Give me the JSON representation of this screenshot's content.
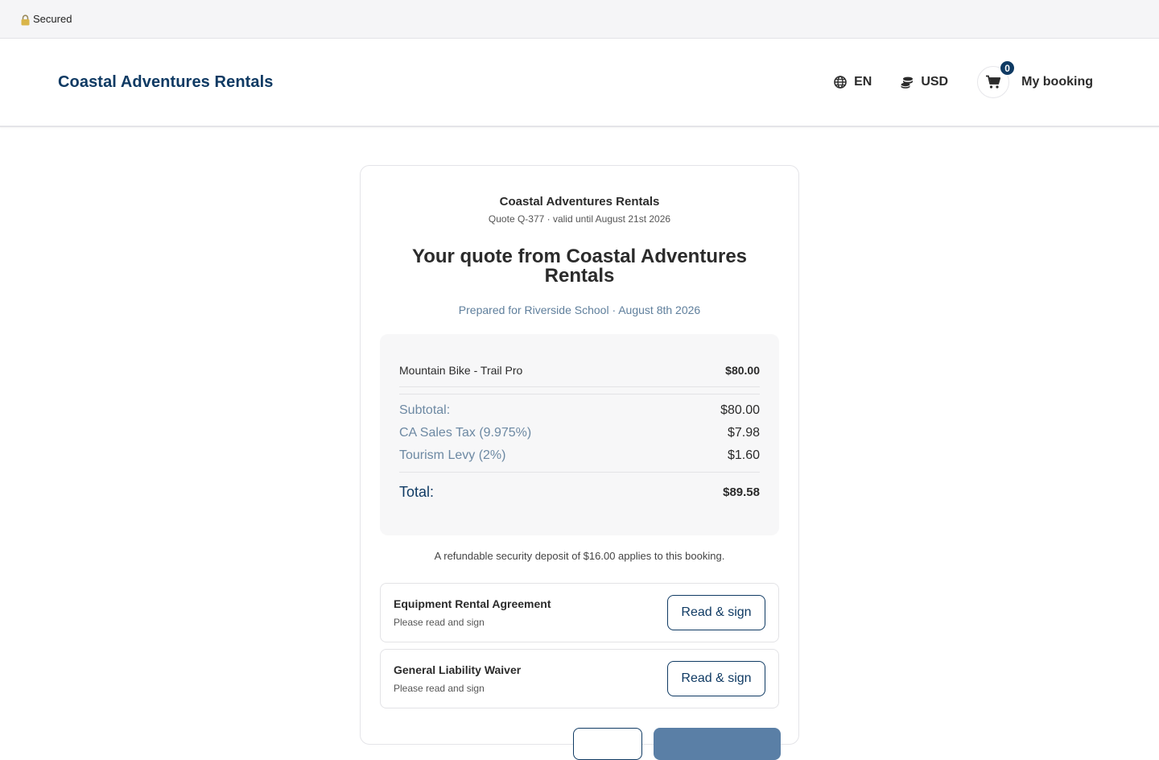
{
  "secure_bar": {
    "label": "Secured"
  },
  "header": {
    "brand": "Coastal Adventures Rentals",
    "language": "EN",
    "currency": "USD",
    "cart_count": "0",
    "booking_label": "My booking"
  },
  "quote": {
    "company": "Coastal Adventures Rentals",
    "meta": "Quote Q-377 · valid until August 21st 2026",
    "title": "Your quote from Coastal Adventures Rentals",
    "prepared": "Prepared for Riverside School · August 8th 2026",
    "items": [
      {
        "name": "Mountain Bike - Trail Pro",
        "amount": "$80.00"
      }
    ],
    "subtotal_label": "Subtotal:",
    "subtotal": "$80.00",
    "tax1_label": "CA Sales Tax (9.975%)",
    "tax1": "$7.98",
    "tax2_label": "Tourism Levy (2%)",
    "tax2": "$1.60",
    "total_label": "Total:",
    "total": "$89.58",
    "deposit_note": "A refundable security deposit of $16.00 applies to this booking."
  },
  "documents": [
    {
      "name": "Equipment Rental Agreement",
      "status": "Please read and sign",
      "action": "Read & sign"
    },
    {
      "name": "General Liability Waiver",
      "status": "Please read and sign",
      "action": "Read & sign"
    }
  ],
  "colors": {
    "brand": "#0f3a63",
    "muted_label": "#6d89a3",
    "primary_button": "#5a7fa6"
  },
  "icons": {
    "lock": "lock-icon",
    "language": "globe-icon",
    "currency": "coins-icon",
    "cart": "cart-icon"
  }
}
